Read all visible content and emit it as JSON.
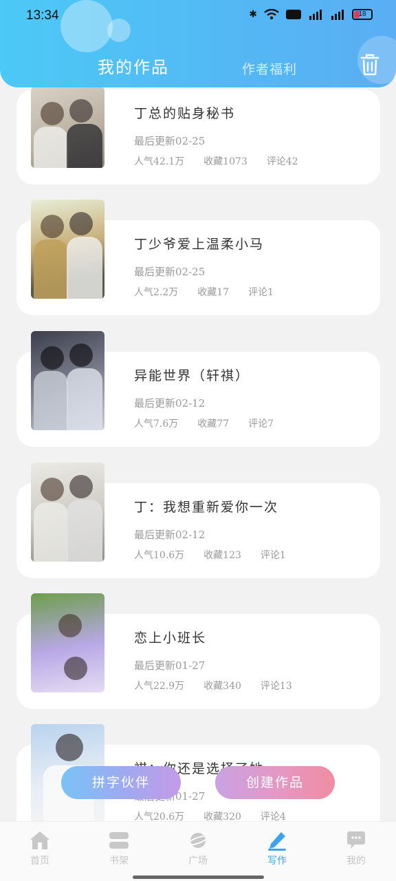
{
  "status_bar": {
    "time": "13:34",
    "battery": "18"
  },
  "header": {
    "tab_mine": "我的作品",
    "tab_welfare": "作者福利"
  },
  "works": [
    {
      "title": "丁总的贴身秘书",
      "updated": "最后更新02-25",
      "popularity": "人气42.1万",
      "collections": "收藏1073",
      "comments": "评论42"
    },
    {
      "title": "丁少爷爱上温柔小马",
      "updated": "最后更新02-25",
      "popularity": "人气2.2万",
      "collections": "收藏17",
      "comments": "评论1"
    },
    {
      "title": "异能世界（轩祺）",
      "updated": "最后更新02-12",
      "popularity": "人气7.6万",
      "collections": "收藏77",
      "comments": "评论7"
    },
    {
      "title": "丁：我想重新爱你一次",
      "updated": "最后更新02-12",
      "popularity": "人气10.6万",
      "collections": "收藏123",
      "comments": "评论1"
    },
    {
      "title": "恋上小班长",
      "updated": "最后更新01-27",
      "popularity": "人气22.9万",
      "collections": "收藏340",
      "comments": "评论13"
    },
    {
      "title": "祺：你还是选择了她……",
      "updated": "最后更新01-27",
      "popularity": "人气20.6万",
      "collections": "收藏320",
      "comments": "评论4"
    }
  ],
  "buttons": {
    "partner": "拼字伙伴",
    "create": "创建作品"
  },
  "bottom_nav": [
    {
      "label": "首页",
      "icon": "home-icon"
    },
    {
      "label": "书架",
      "icon": "bookshelf-icon"
    },
    {
      "label": "广场",
      "icon": "planet-icon"
    },
    {
      "label": "写作",
      "icon": "pen-icon",
      "active": true
    },
    {
      "label": "我的",
      "icon": "chat-bubble-icon"
    }
  ],
  "colors": {
    "header_start": "#4cc9f6",
    "header_end": "#5aaef3",
    "active_nav": "#3aa2ee",
    "inactive_nav": "#c4c4c4"
  }
}
